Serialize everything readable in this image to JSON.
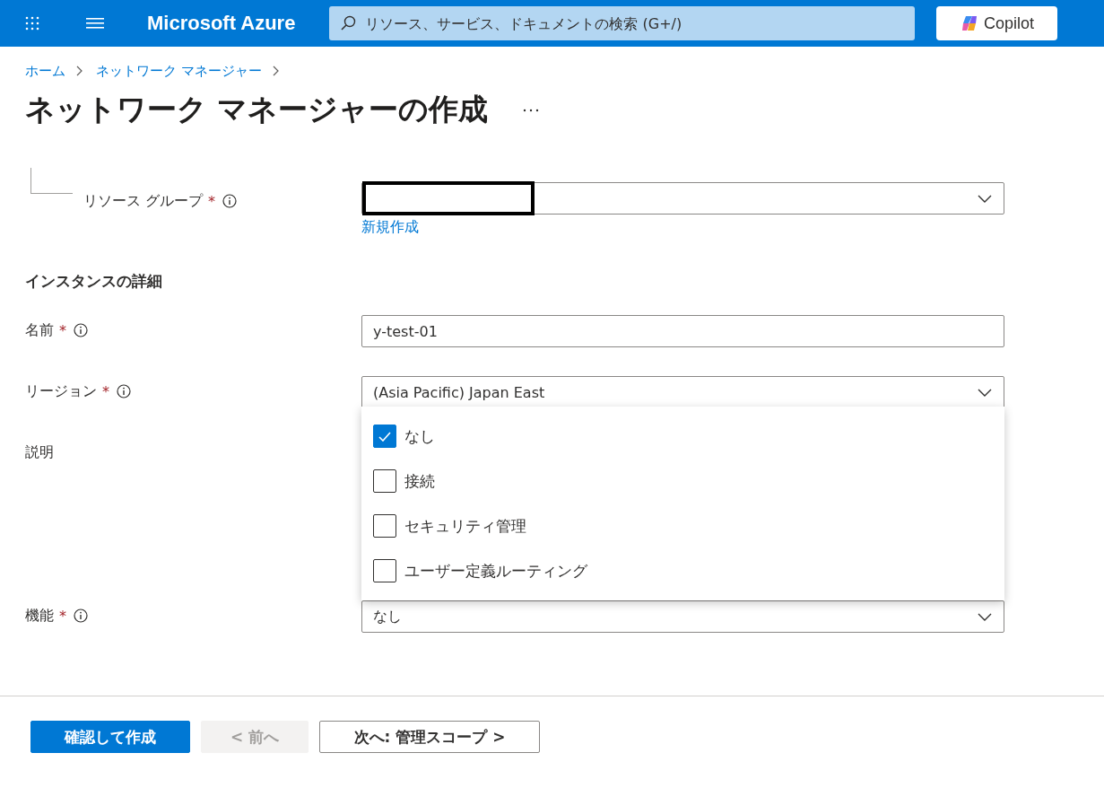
{
  "header": {
    "app_title": "Microsoft Azure",
    "search": {
      "placeholder": "リソース、サービス、ドキュメントの検索 (G+/)"
    },
    "copilot_button": "Copilot"
  },
  "breadcrumb": [
    "ホーム",
    "ネットワーク マネージャー"
  ],
  "page_title": "ネットワーク マネージャーの作成",
  "resource_group": {
    "label": "リソース グループ",
    "required_mark": "*",
    "info": true,
    "create_link": "新規作成"
  },
  "section_heading": "インスタンスの詳細",
  "fields": [
    {
      "kind": "text",
      "label": "名前",
      "required_mark": "*",
      "info": true,
      "value": "y-test-01"
    },
    {
      "kind": "select",
      "label": "リージョン",
      "required_mark": "*",
      "info": true,
      "value": "(Asia Pacific) Japan East"
    },
    {
      "kind": "textarea",
      "label": "説明",
      "info": false
    },
    {
      "kind": "multiselect",
      "label": "機能",
      "required_mark": "*",
      "info": true,
      "value": "なし",
      "expanded": true,
      "options": [
        {
          "label": "なし",
          "checked": true
        },
        {
          "label": "接続",
          "checked": false
        },
        {
          "label": "セキュリティ管理",
          "checked": false
        },
        {
          "label": "ユーザー定義ルーティング",
          "checked": false
        }
      ]
    }
  ],
  "footer_buttons": [
    {
      "label": "確認して作成",
      "kind": "primary",
      "disabled": false
    },
    {
      "label": "< 前へ",
      "kind": "secondary",
      "disabled": true
    },
    {
      "label": "次へ: 管理スコープ >",
      "kind": "secondary",
      "disabled": false
    }
  ]
}
